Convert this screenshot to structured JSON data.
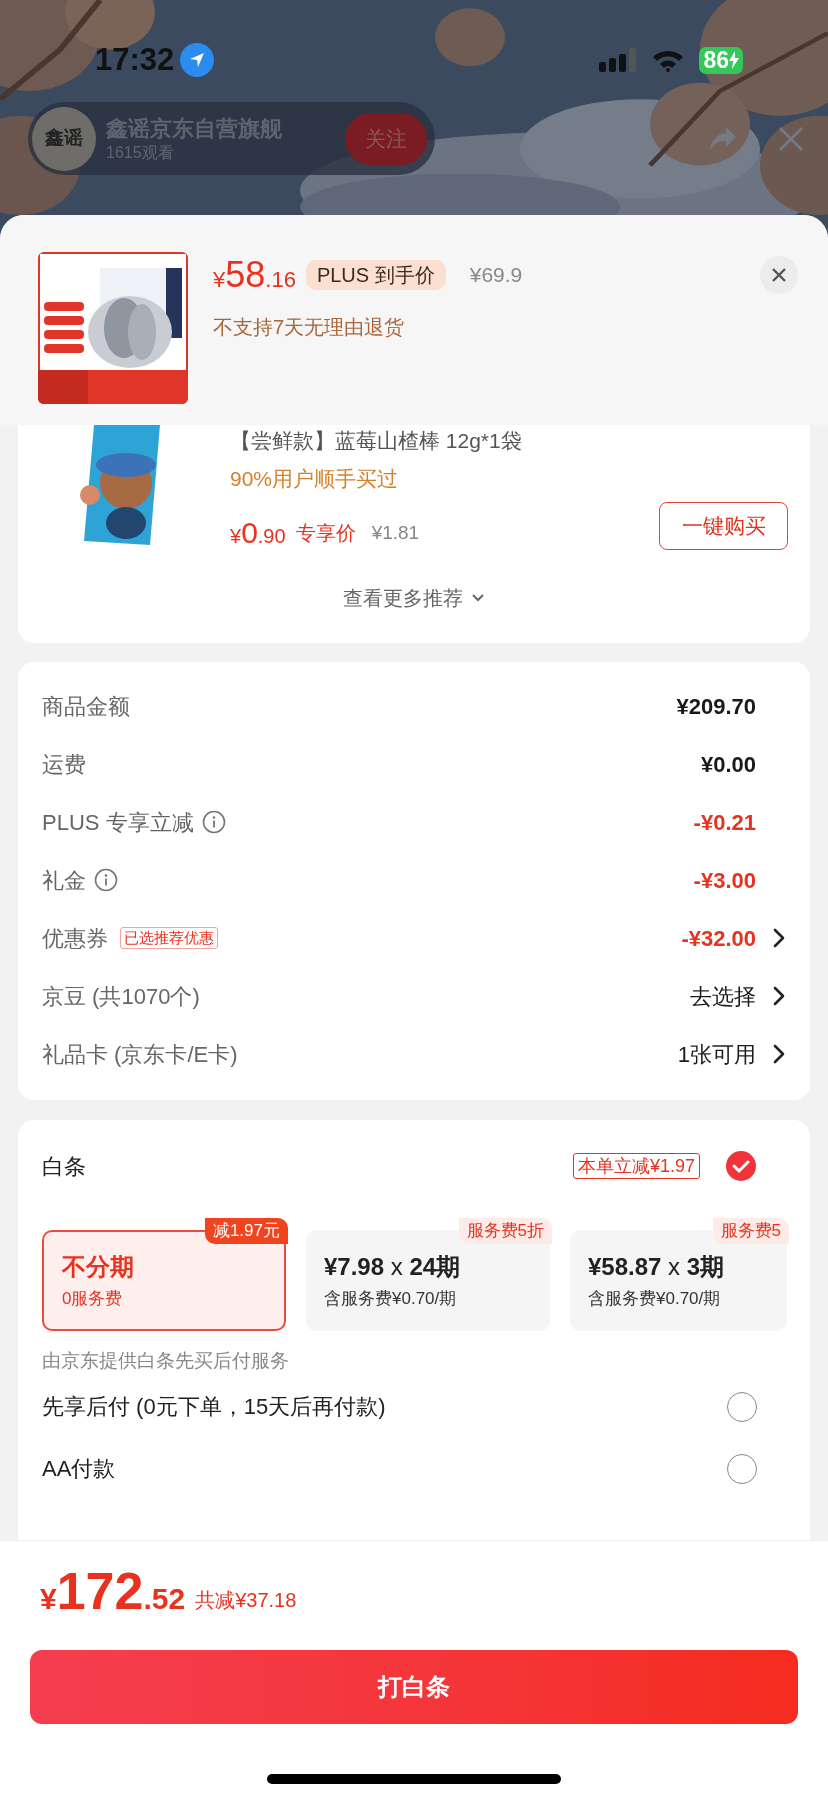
{
  "status_bar": {
    "time": "17:32",
    "battery": "86"
  },
  "live": {
    "avatar_text": "鑫谣",
    "store_name": "鑫谣京东自营旗舰",
    "viewers": "1615观看",
    "follow": "关注"
  },
  "product": {
    "symbol": "¥",
    "price_int": "58",
    "price_dec": ".16",
    "plus_badge": "PLUS 到手价",
    "original_price": "¥69.9",
    "notice": "不支持7天无理由退货"
  },
  "recommendation": {
    "title": "【尝鲜款】蓝莓山楂棒 12g*1袋",
    "social_proof": "90%用户顺手买过",
    "symbol": "¥",
    "price_int": "0",
    "price_dec": ".90",
    "price_label": "专享价",
    "original_price": "¥1.81",
    "buy_button": "一键购买",
    "more": "查看更多推荐"
  },
  "fees": [
    {
      "label": "商品金额",
      "value": "¥209.70",
      "kind": "amount"
    },
    {
      "label": "运费",
      "value": "¥0.00",
      "kind": "amount"
    },
    {
      "label": "PLUS 专享立减",
      "value": "-¥0.21",
      "kind": "discount",
      "info": true
    },
    {
      "label": "礼金",
      "value": "-¥3.00",
      "kind": "discount",
      "info": true
    },
    {
      "label": "优惠券",
      "tag": "已选推荐优惠",
      "value": "-¥32.00",
      "kind": "discount",
      "chevron": true
    },
    {
      "label": "京豆 (共1070个)",
      "value": "去选择",
      "kind": "choice",
      "chevron": true
    },
    {
      "label": "礼品卡 (京东卡/E卡)",
      "value": "1张可用",
      "kind": "choice",
      "chevron": true
    }
  ],
  "baitiao": {
    "title": "白条",
    "badge": "本单立减¥1.97",
    "checked": true,
    "plans": [
      {
        "kind": "full",
        "main": "不分期",
        "sub": "0服务费",
        "tag": "减1.97元",
        "selected": true
      },
      {
        "kind": "installment",
        "amount": "¥7.98",
        "multiplier": "x",
        "term": "24期",
        "sub": "含服务费¥0.70/期",
        "tag": "服务费5折",
        "selected": false
      },
      {
        "kind": "installment",
        "amount": "¥58.87",
        "multiplier": "x",
        "term": "3期",
        "sub": "含服务费¥0.70/期",
        "tag": "服务费5",
        "selected": false
      }
    ],
    "note": "由京东提供白条先买后付服务"
  },
  "payment_options": [
    {
      "label": "先享后付 (0元下单，15天后再付款)",
      "selected": false
    },
    {
      "label": "AA付款",
      "selected": false
    }
  ],
  "bottom": {
    "symbol": "¥",
    "total_int": "172",
    "total_dec": ".52",
    "saved": "共减¥37.18",
    "pay_button": "打白条"
  }
}
